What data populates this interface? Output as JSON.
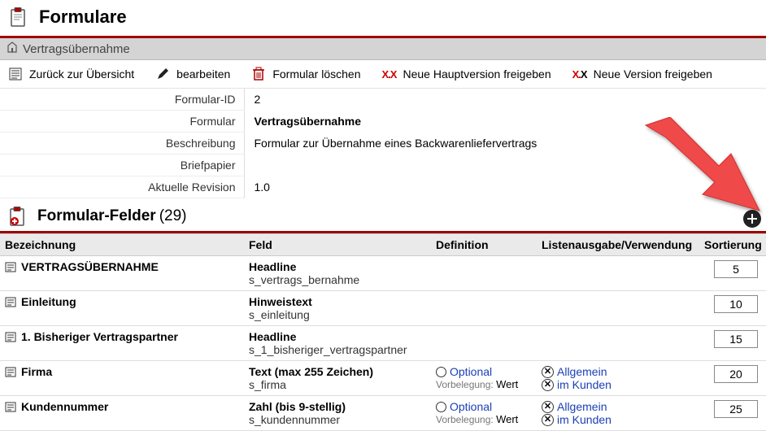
{
  "header": {
    "title": "Formulare",
    "breadcrumb": "Vertragsübernahme"
  },
  "toolbar": {
    "back": "Zurück zur Übersicht",
    "edit": "bearbeiten",
    "delete": "Formular löschen",
    "majorRelease": "Neue Hauptversion freigeben",
    "minorRelease": "Neue Version freigeben"
  },
  "details": {
    "l_id": "Formular-ID",
    "v_id": "2",
    "l_name": "Formular",
    "v_name": "Vertragsübernahme",
    "l_desc": "Beschreibung",
    "v_desc": "Formular zur Übernahme eines Backwarenliefervertrags",
    "l_paper": "Briefpapier",
    "v_paper": "",
    "l_rev": "Aktuelle Revision",
    "v_rev": "1.0"
  },
  "section": {
    "title": "Formular-Felder",
    "count": "(29)"
  },
  "columns": {
    "bez": "Bezeichnung",
    "feld": "Feld",
    "def": "Definition",
    "list": "Listenausgabe/Verwendung",
    "sort": "Sortierung"
  },
  "defLabels": {
    "optional": "Optional",
    "prefillLabel": "Vorbelegung:",
    "prefillValue": "Wert",
    "allgemein": "Allgemein",
    "imKunden": "im Kunden"
  },
  "rows": [
    {
      "bez": "VERTRAGSÜBERNAHME",
      "ftype": "Headline",
      "fcode": "s_vertrags_bernahme",
      "hasDef": false,
      "sort": "5"
    },
    {
      "bez": "Einleitung",
      "ftype": "Hinweistext",
      "fcode": "s_einleitung",
      "hasDef": false,
      "sort": "10"
    },
    {
      "bez": "1. Bisheriger Vertragspartner",
      "ftype": "Headline",
      "fcode": "s_1_bisheriger_vertragspartner",
      "hasDef": false,
      "sort": "15"
    },
    {
      "bez": "Firma",
      "ftype": "Text (max 255 Zeichen)",
      "fcode": "s_firma",
      "hasDef": true,
      "sort": "20"
    },
    {
      "bez": "Kundennummer",
      "ftype": "Zahl (bis 9-stellig)",
      "fcode": "s_kundennummer",
      "hasDef": true,
      "sort": "25"
    }
  ]
}
